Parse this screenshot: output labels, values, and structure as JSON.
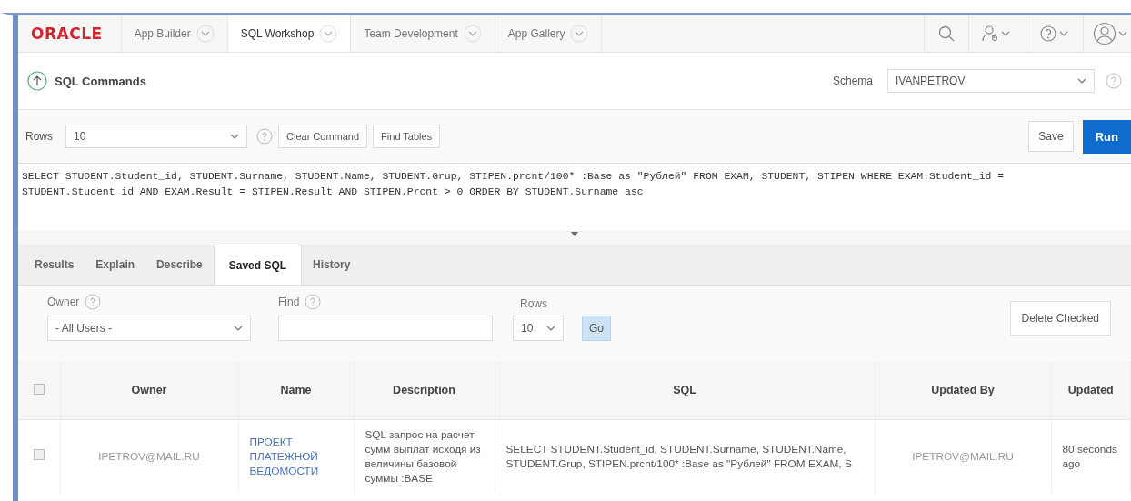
{
  "header": {
    "logo": "ORACLE",
    "tabs": [
      {
        "label": "App Builder",
        "selected": false
      },
      {
        "label": "SQL Workshop",
        "selected": true
      },
      {
        "label": "Team Development",
        "selected": false
      },
      {
        "label": "App Gallery",
        "selected": false
      }
    ]
  },
  "page": {
    "title": "SQL Commands",
    "schema_label": "Schema",
    "schema_value": "IVANPETROV"
  },
  "toolbar": {
    "rows_label": "Rows",
    "rows_value": "10",
    "buttons": [
      "Clear Command",
      "Find Tables"
    ],
    "save": "Save",
    "run": "Run"
  },
  "editor": {
    "value": "SELECT STUDENT.Student_id, STUDENT.Surname, STUDENT.Name, STUDENT.Grup, STIPEN.prcnt/100* :Base as \"Рублей\" FROM EXAM, STUDENT, STIPEN WHERE EXAM.Student_id = STUDENT.Student_id AND EXAM.Result = STIPEN.Result AND STIPEN.Prcnt > 0 ORDER BY STUDENT.Surname asc"
  },
  "result_tabs": [
    {
      "label": "Results",
      "selected": false
    },
    {
      "label": "Explain",
      "selected": false
    },
    {
      "label": "Describe",
      "selected": false
    },
    {
      "label": "Saved SQL",
      "selected": true
    },
    {
      "label": "History",
      "selected": false
    }
  ],
  "filters": {
    "owner_label": "Owner",
    "owner_value": "- All Users -",
    "find_label": "Find",
    "rows_label": "Rows",
    "rows_value": "10",
    "go": "Go",
    "delete": "Delete Checked"
  },
  "table": {
    "select_all_checked": false,
    "columns": [
      "Owner",
      "Name",
      "Description",
      "SQL",
      "Updated By",
      "Updated"
    ],
    "rows": [
      {
        "checked": false,
        "owner": "IPETROV@MAIL.RU",
        "name": "ПРОЕКТ ПЛАТЕЖНОЙ ВЕДОМОСТИ",
        "description": "SQL запрос на расчет сумм выплат исходя из величины базовой суммы :BASE",
        "sql": "SELECT STUDENT.Student_id, STUDENT.Surname, STUDENT.Name, STUDENT.Grup, STIPEN.prcnt/100* :Base as \"Рублей\" FROM EXAM, S",
        "updated_by": "IPETROV@MAIL.RU",
        "updated": "80 seconds ago"
      }
    ]
  }
}
